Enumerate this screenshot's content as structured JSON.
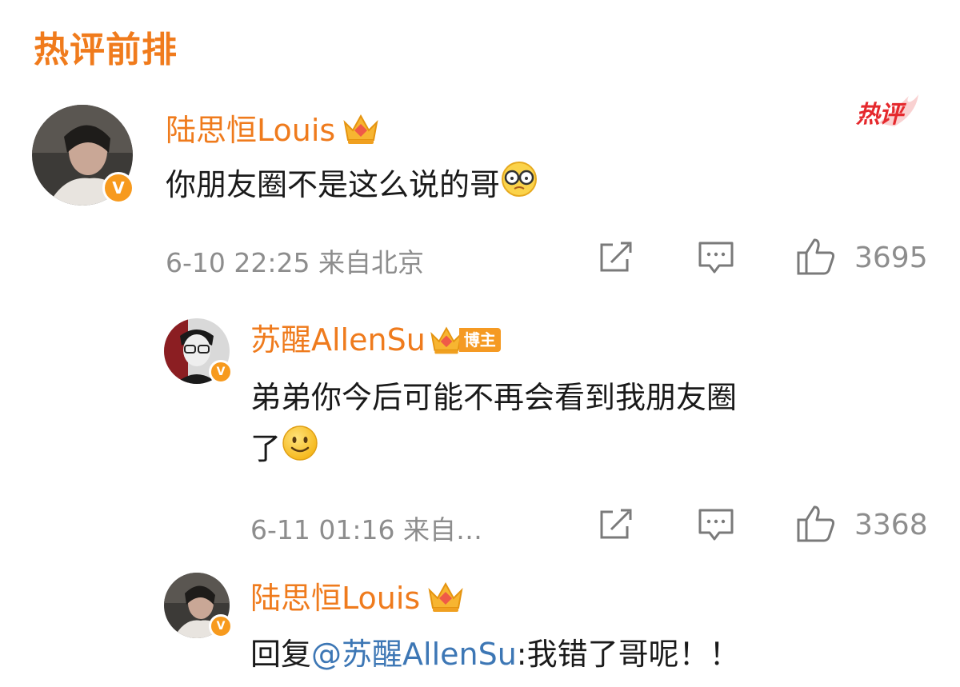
{
  "section": {
    "title": "热评前排"
  },
  "hot_badge": {
    "label": "热评"
  },
  "comments": [
    {
      "user": "陆思恒Louis",
      "text": "你朋友圈不是这么说的哥",
      "emoji": "glasses-face-emoji",
      "meta": "6-10 22:25  来自北京",
      "likes": "3695"
    },
    {
      "user": "苏醒AllenSu",
      "host_tag": "博主",
      "text_line1": "弟弟你今后可能不再会看到我朋友圈",
      "text_line2": "了",
      "emoji": "smile-emoji",
      "meta": "6-11 01:16  来自…",
      "likes": "3368"
    },
    {
      "user": "陆思恒Louis",
      "reply_prefix": "回复",
      "mention": "@苏醒AllenSu",
      "reply_text": ":我错了哥呢！！"
    }
  ],
  "icons": {
    "share": "share-icon",
    "comment": "comment-icon",
    "like": "thumbs-up-icon",
    "crown": "crown-icon",
    "verified": "verified-v-icon"
  },
  "colors": {
    "accent_orange": "#ef7b1d",
    "mention_blue": "#3d77b5",
    "meta_gray": "#8d8d8d",
    "hot_red": "#e5292d"
  }
}
